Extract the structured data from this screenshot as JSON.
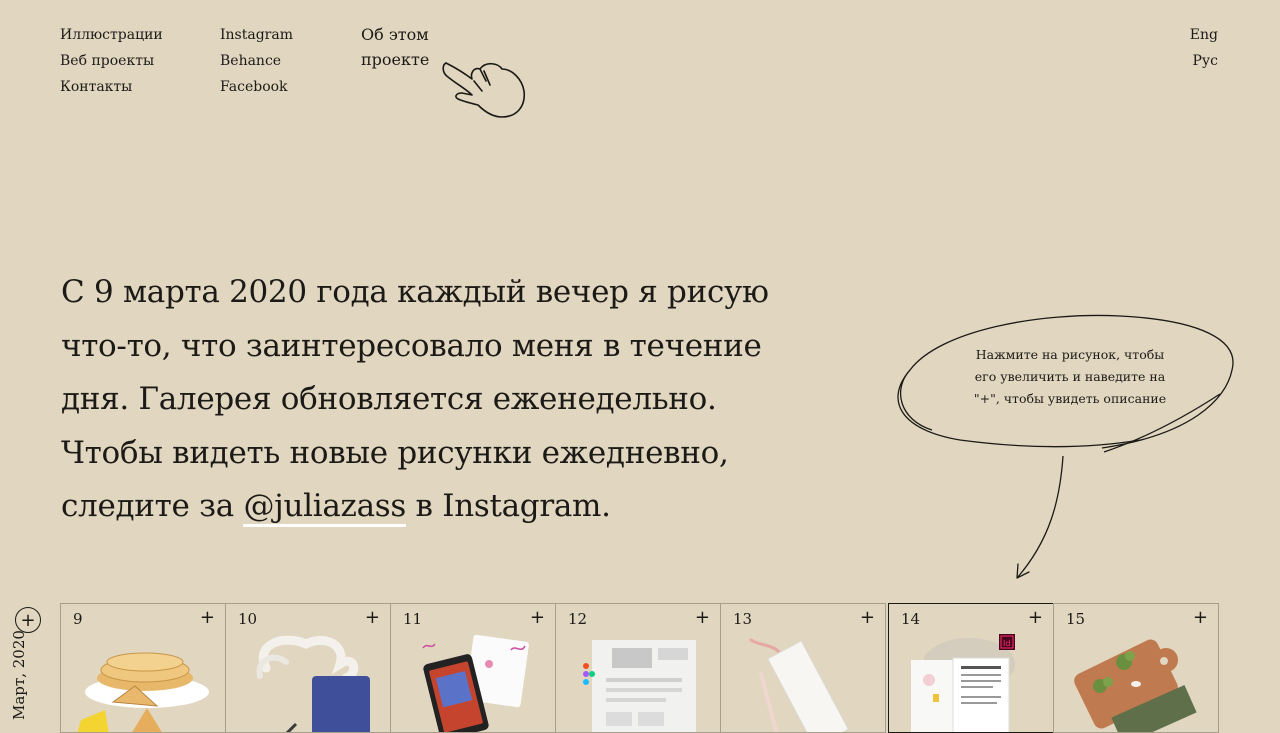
{
  "nav": {
    "col1": [
      "Иллюстрации",
      "Веб проекты",
      "Контакты"
    ],
    "col2": [
      "Instagram",
      "Behance",
      "Facebook"
    ],
    "about": [
      "Об этом",
      "проекте"
    ],
    "lang": [
      "Eng",
      "Рус"
    ]
  },
  "intro": {
    "line1": "С 9 марта 2020 года каждый вечер я рисую",
    "line2": "что-то, что заинтересовало меня в течение",
    "line3": "дня. Галерея обновляется еженедельно.",
    "line4": "Чтобы видеть новые рисунки ежедневно,",
    "line5a": "следите за ",
    "handle": "@juliazass",
    "line5b": " в Instagram."
  },
  "bubble": {
    "line1": "Нажмите на рисунок, чтобы",
    "line2": "его увеличить и наведите на",
    "line3": "\"+\", чтобы увидеть описание"
  },
  "sidebar": {
    "plus": "+",
    "month": "Март, 2020"
  },
  "gallery": {
    "plus": "+",
    "days": [
      "9",
      "10",
      "11",
      "12",
      "13",
      "14",
      "15"
    ],
    "images": [
      "pancakes",
      "steaming-mug",
      "tablet-with-stickers",
      "web-layout",
      "pencil-box",
      "indesign-document",
      "cutting-board-with-broccoli"
    ]
  }
}
